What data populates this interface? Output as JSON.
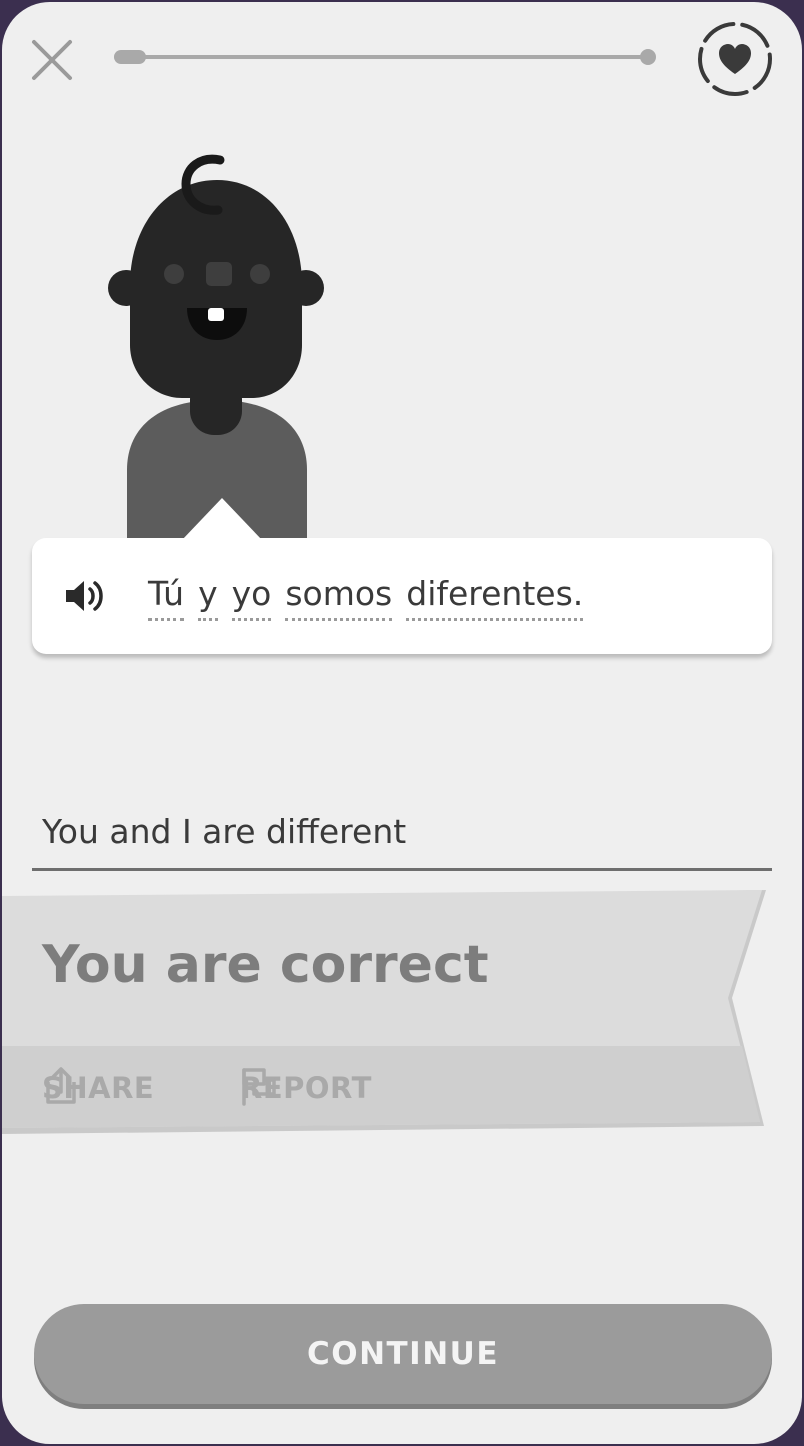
{
  "header": {
    "close_icon": "close-icon",
    "progress_fraction": 0.06,
    "hearts_icon": "heart-icon"
  },
  "prompt": {
    "speaker_icon": "speaker-icon",
    "words": [
      "Tú",
      "y",
      "yo",
      "somos",
      "diferentes."
    ]
  },
  "answer": {
    "text": "You and I are different"
  },
  "feedback": {
    "verdict": "You are correct",
    "share_label": "SHARE",
    "share_icon": "share-icon",
    "report_label": "REPORT",
    "report_icon": "flag-icon"
  },
  "footer": {
    "continue_label": "CONTINUE"
  },
  "colors": {
    "background": "#efefef",
    "frame": "#3b2f4f",
    "ribbon": "#d9d9d9",
    "button": "#9b9b9b"
  }
}
